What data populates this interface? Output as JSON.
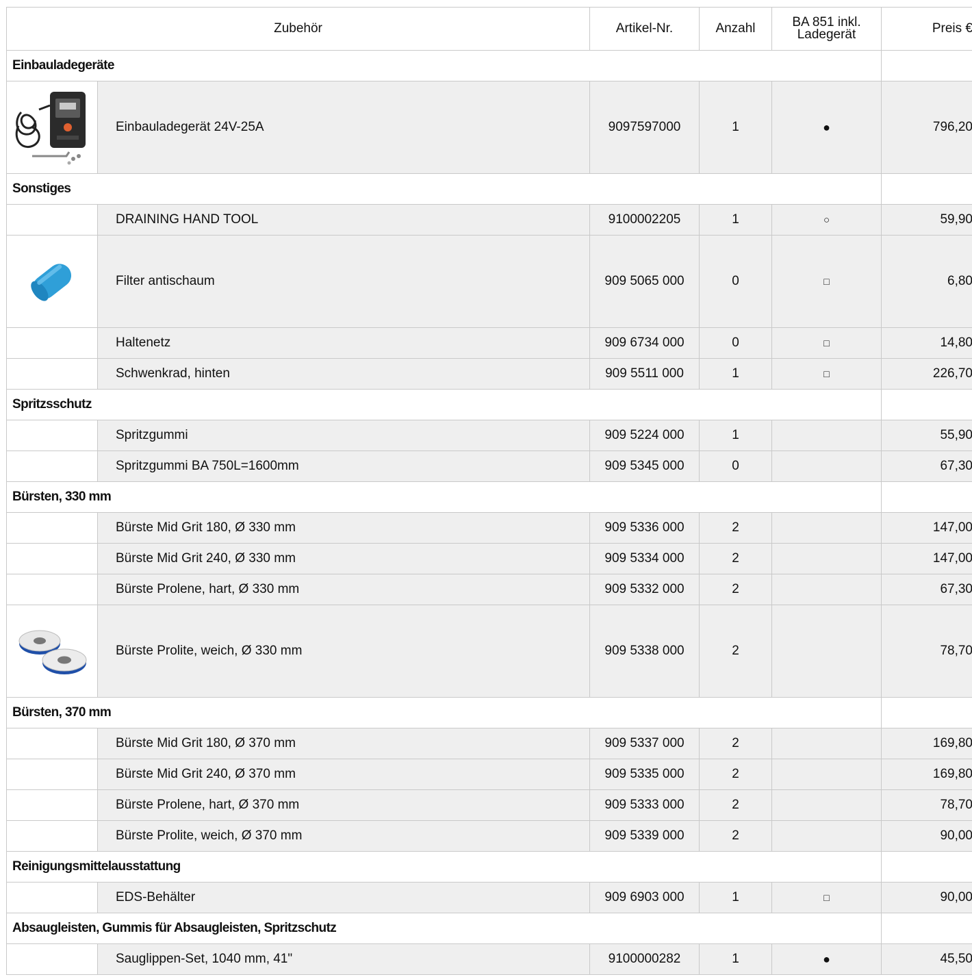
{
  "header": {
    "zubehoer": "Zubehör",
    "artikel": "Artikel-Nr.",
    "anzahl": "Anzahl",
    "ba_line1": "BA 851 inkl.",
    "ba_line2": "Ladegerät",
    "preis": "Preis €"
  },
  "categories": [
    {
      "title": "Einbauladegeräte",
      "items": [
        {
          "name": "Einbauladegerät 24V-25A",
          "art": "9097597000",
          "qty": "1",
          "mark": "●",
          "price": "796,20",
          "image": "charger-image"
        }
      ]
    },
    {
      "title": "Sonstiges",
      "items": [
        {
          "name": "DRAINING HAND TOOL",
          "art": "9100002205",
          "qty": "1",
          "mark": "○",
          "price": "59,90"
        },
        {
          "name": "Filter antischaum",
          "art": "909 5065 000",
          "qty": "0",
          "mark": "□",
          "price": "6,80",
          "image": "foam-filter-image"
        },
        {
          "name": "Haltenetz",
          "art": "909 6734 000",
          "qty": "0",
          "mark": "□",
          "price": "14,80"
        },
        {
          "name": "Schwenkrad, hinten",
          "art": "909 5511 000",
          "qty": "1",
          "mark": "□",
          "price": "226,70"
        }
      ]
    },
    {
      "title": "Spritzsschutz",
      "items": [
        {
          "name": "Spritzgummi",
          "art": "909 5224 000",
          "qty": "1",
          "mark": "",
          "price": "55,90"
        },
        {
          "name": "Spritzgummi BA 750L=1600mm",
          "art": "909 5345 000",
          "qty": "0",
          "mark": "",
          "price": "67,30"
        }
      ]
    },
    {
      "title": "Bürsten, 330 mm",
      "items": [
        {
          "name": "Bürste Mid Grit 180, Ø 330 mm",
          "art": "909 5336 000",
          "qty": "2",
          "mark": "",
          "price": "147,00"
        },
        {
          "name": "Bürste Mid Grit 240, Ø 330 mm",
          "art": "909 5334 000",
          "qty": "2",
          "mark": "",
          "price": "147,00"
        },
        {
          "name": "Bürste Prolene, hart, Ø 330 mm",
          "art": "909 5332 000",
          "qty": "2",
          "mark": "",
          "price": "67,30"
        },
        {
          "name": "Bürste Prolite, weich, Ø 330 mm",
          "art": "909 5338 000",
          "qty": "2",
          "mark": "",
          "price": "78,70",
          "image": "brush-pads-image"
        }
      ]
    },
    {
      "title": "Bürsten, 370 mm",
      "items": [
        {
          "name": "Bürste Mid Grit 180, Ø 370 mm",
          "art": "909 5337 000",
          "qty": "2",
          "mark": "",
          "price": "169,80"
        },
        {
          "name": "Bürste Mid Grit 240, Ø 370 mm",
          "art": "909 5335 000",
          "qty": "2",
          "mark": "",
          "price": "169,80"
        },
        {
          "name": "Bürste Prolene, hart, Ø 370 mm",
          "art": "909 5333 000",
          "qty": "2",
          "mark": "",
          "price": "78,70"
        },
        {
          "name": "Bürste Prolite, weich, Ø 370 mm",
          "art": "909 5339 000",
          "qty": "2",
          "mark": "",
          "price": "90,00"
        }
      ]
    },
    {
      "title": "Reinigungsmittelausstattung",
      "items": [
        {
          "name": "EDS-Behälter",
          "art": "909 6903 000",
          "qty": "1",
          "mark": "□",
          "price": "90,00"
        }
      ]
    },
    {
      "title": "Absaugleisten, Gummis für Absaugleisten, Spritzschutz",
      "items": [
        {
          "name": "Sauglippen-Set, 1040 mm, 41\"",
          "art": "9100000282",
          "qty": "1",
          "mark": "●",
          "price": "45,50"
        }
      ]
    }
  ],
  "colors": {
    "border": "#c9c9c9",
    "row_bg": "#efefef",
    "filter_blue": "#2f9fd8",
    "brush_blue": "#1f4fa8"
  }
}
